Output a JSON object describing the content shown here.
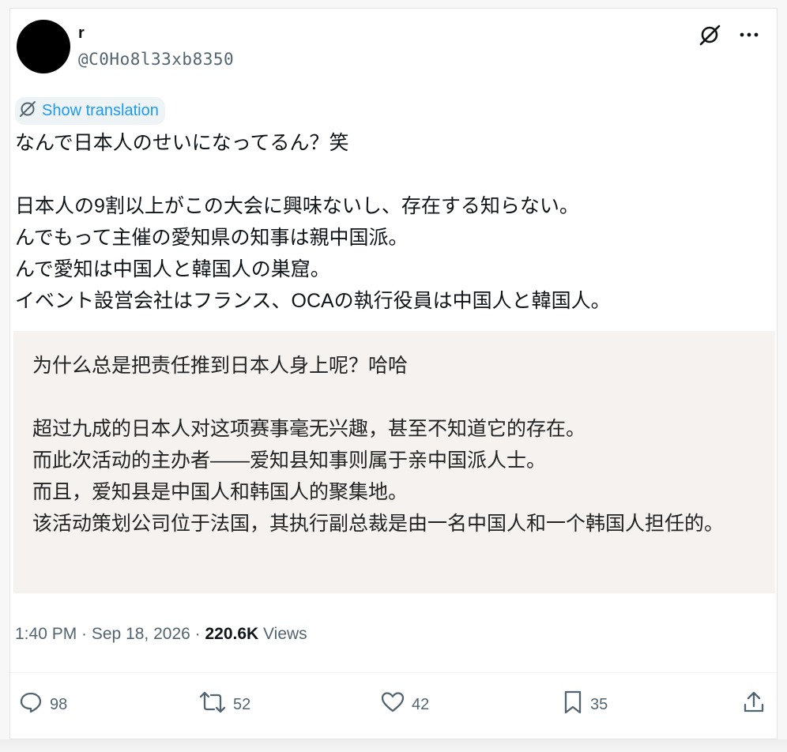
{
  "tweet": {
    "display_name": "r",
    "handle": "@C0Ho8l33xb8350",
    "show_translation_label": "Show translation",
    "original_text": "なんで日本人のせいになってるん？笑\n\n日本人の9割以上がこの大会に興味ないし、存在する知らない。\nんでもって主催の愛知県の知事は親中国派。\nんで愛知は中国人と韓国人の巣窟。\nイベント設営会社はフランス、OCAの執行役員は中国人と韓国人。",
    "translated_text": "为什么总是把责任推到日本人身上呢？哈哈\n\n超过九成的日本人对这项赛事毫无兴趣，甚至不知道它的存在。\n而此次活动的主办者——爱知县知事则属于亲中国派人士。\n而且，爱知县是中国人和韩国人的聚集地。\n该活动策划公司位于法国，其执行副总裁是由一名中国人和一个韩国人担任的。",
    "timestamp": "1:40 PM · Sep 18, 2026 · ",
    "views_count": "220.6K",
    "views_label": " Views",
    "replies": "98",
    "retweets": "52",
    "likes": "42",
    "bookmarks": "35"
  },
  "colors": {
    "text": "#0f1419",
    "secondary": "#536471",
    "link": "#1d9bf0",
    "translation_bg": "#f6f2f0"
  },
  "icons": [
    "grok-icon",
    "more-icon",
    "translate-icon",
    "reply-icon",
    "retweet-icon",
    "like-icon",
    "bookmark-icon",
    "share-icon"
  ]
}
